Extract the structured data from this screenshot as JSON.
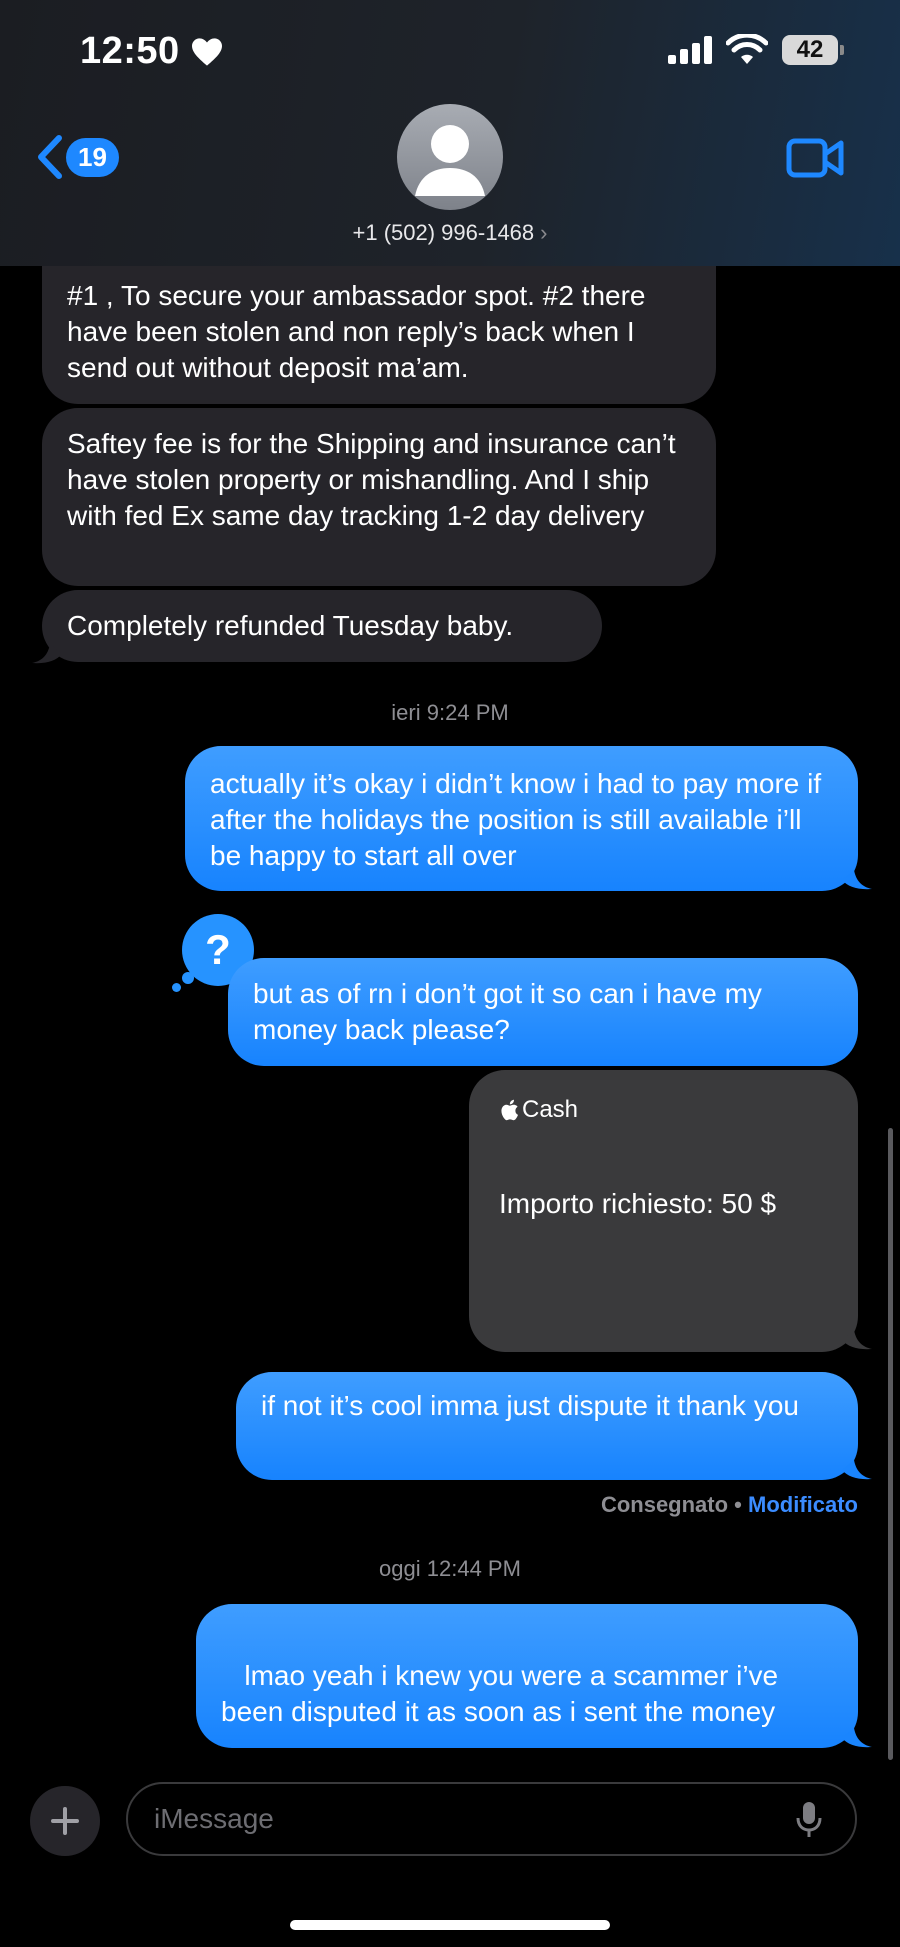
{
  "status": {
    "time": "12:50",
    "battery": "42"
  },
  "header": {
    "back_count": "19",
    "contact": "+1 (502) 996-1468",
    "chevron": "›"
  },
  "messages": {
    "in1": "#1 , To secure your ambassador spot. #2 there have been stolen and non reply’s back when I send out without deposit ma’am.",
    "in2": "Saftey fee is for the Shipping and insurance can’t have stolen property or mishandling. And I ship with fed Ex same day tracking 1-2 day delivery",
    "in3": "Completely refunded Tuesday baby.",
    "ts1_day": "ieri",
    "ts1_time": "9:24 PM",
    "out1": "actually it’s okay i didn’t know i had to pay more if after the holidays the position is still available i’ll be happy to start all over",
    "out2_badge": "?",
    "out2": "but as of rn i don’t got it so can i have my money back please?",
    "cash_brand": "Cash",
    "cash_amount": "Importo richiesto: 50 $",
    "out3": "if not it’s cool imma just dispute it thank you",
    "delivered": "Consegnato",
    "dot": " • ",
    "edited": "Modificato",
    "ts2_day": "oggi",
    "ts2_time": "12:44 PM",
    "out4": " lmao yeah i knew you were a scammer i’ve been disputed it as soon as i sent the money"
  },
  "composer": {
    "placeholder": "iMessage"
  },
  "colors": {
    "outgoing": "#1e88ff",
    "incoming": "#26252a",
    "accent": "#3b8cff"
  }
}
